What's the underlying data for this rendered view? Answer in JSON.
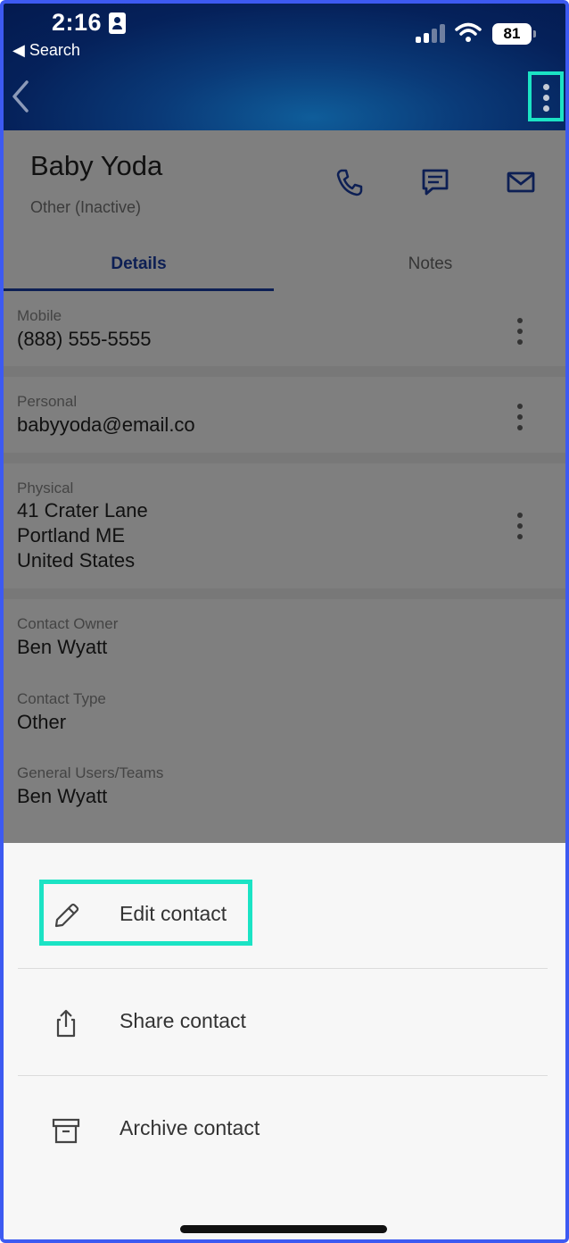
{
  "status_bar": {
    "time": "2:16",
    "back_app": "◀ Search",
    "battery": "81"
  },
  "contact": {
    "name": "Baby Yoda",
    "status": "Other (Inactive)"
  },
  "tabs": [
    {
      "label": "Details",
      "active": true
    },
    {
      "label": "Notes",
      "active": false
    }
  ],
  "fields": {
    "mobile": {
      "label": "Mobile",
      "value": "(888) 555-5555"
    },
    "personal": {
      "label": "Personal",
      "value": "babyyoda@email.co"
    },
    "physical": {
      "label": "Physical",
      "line1": "41 Crater Lane",
      "line2": "Portland  ME",
      "line3": "United States"
    },
    "owner": {
      "label": "Contact Owner",
      "value": "Ben Wyatt"
    },
    "type": {
      "label": "Contact Type",
      "value": "Other"
    },
    "users": {
      "label": "General Users/Teams",
      "value": "Ben Wyatt"
    }
  },
  "sheet": {
    "items": [
      {
        "label": "Edit contact",
        "icon": "pencil-icon"
      },
      {
        "label": "Share contact",
        "icon": "share-icon"
      },
      {
        "label": "Archive contact",
        "icon": "archive-icon"
      }
    ]
  },
  "colors": {
    "accent": "#1a3fa8",
    "highlight": "#1be3c4",
    "header": "#05215a"
  }
}
